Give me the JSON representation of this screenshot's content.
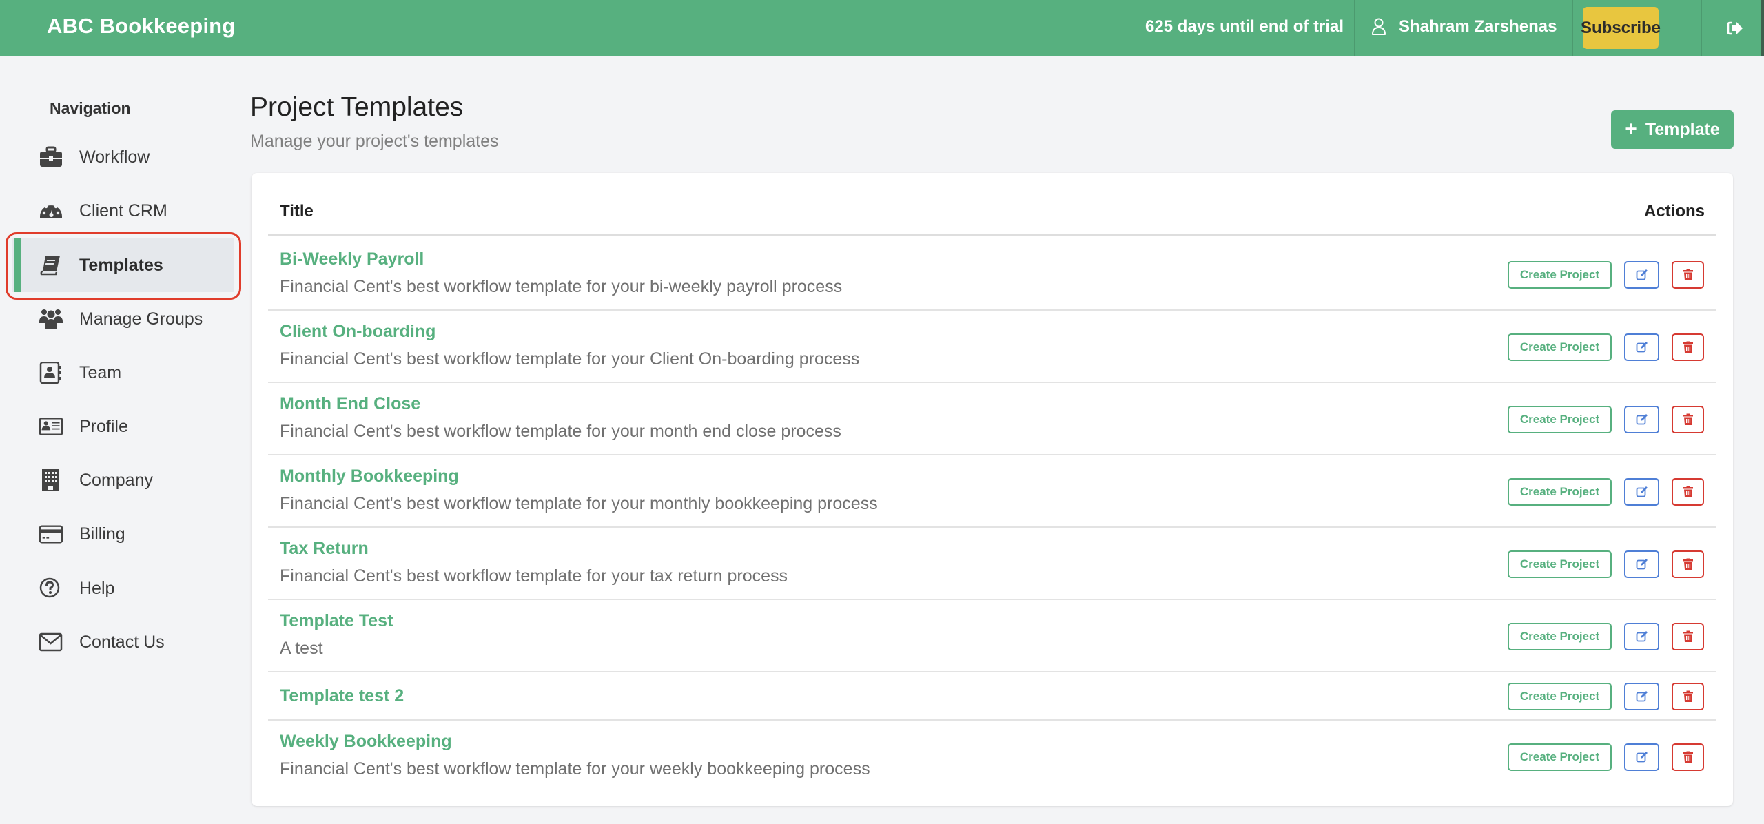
{
  "app": {
    "brand": "ABC Bookkeeping",
    "trial_text": "625 days until end of trial",
    "user_name": "Shahram Zarshenas",
    "subscribe_label": "Subscribe",
    "icons": {
      "user": "user-outline-icon",
      "logout": "sign-out-icon"
    },
    "colors": {
      "primary": "#57b07f",
      "subscribe": "#e8c63f",
      "edit": "#4f7fd6",
      "delete": "#d63a32",
      "highlight": "#e03c2b"
    }
  },
  "sidebar": {
    "heading": "Navigation",
    "active": "Templates",
    "items": [
      {
        "label": "Workflow",
        "icon": "briefcase-icon"
      },
      {
        "label": "Client CRM",
        "icon": "dashboard-gauge-icon"
      },
      {
        "label": "Templates",
        "icon": "book-icon"
      },
      {
        "label": "Manage Groups",
        "icon": "users-icon"
      },
      {
        "label": "Team",
        "icon": "address-book-icon"
      },
      {
        "label": "Profile",
        "icon": "id-card-icon"
      },
      {
        "label": "Company",
        "icon": "building-icon"
      },
      {
        "label": "Billing",
        "icon": "credit-card-icon"
      },
      {
        "label": "Help",
        "icon": "question-circle-icon"
      },
      {
        "label": "Contact Us",
        "icon": "envelope-icon"
      }
    ]
  },
  "main": {
    "title": "Project Templates",
    "subtitle": "Manage your project's templates",
    "add_button": {
      "plus": "+",
      "label": "Template"
    },
    "table": {
      "columns": [
        "Title",
        "Actions"
      ],
      "action_labels": {
        "create": "Create Project",
        "edit": "edit-icon",
        "delete": "trash-icon"
      },
      "rows": [
        {
          "title": "Bi-Weekly Payroll",
          "description": "Financial Cent's best workflow template for your bi-weekly payroll process"
        },
        {
          "title": "Client On-boarding",
          "description": "Financial Cent's best workflow template for your Client On-boarding process"
        },
        {
          "title": "Month End Close",
          "description": "Financial Cent's best workflow template for your month end close process"
        },
        {
          "title": "Monthly Bookkeeping",
          "description": "Financial Cent's best workflow template for your monthly bookkeeping process"
        },
        {
          "title": "Tax Return",
          "description": "Financial Cent's best workflow template for your tax return process"
        },
        {
          "title": "Template Test",
          "description": "A test"
        },
        {
          "title": "Template test 2",
          "description": ""
        },
        {
          "title": "Weekly Bookkeeping",
          "description": "Financial Cent's best workflow template for your weekly bookkeeping process"
        }
      ]
    }
  }
}
